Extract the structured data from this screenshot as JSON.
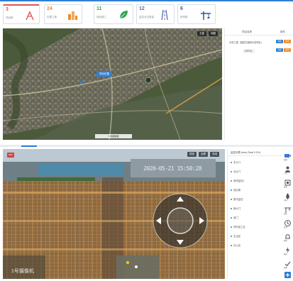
{
  "stats": [
    {
      "value": "3",
      "label": "项目数",
      "icon": "crane-icon"
    },
    {
      "value": "24",
      "label": "在建工程",
      "icon": "building-icon"
    },
    {
      "value": "11",
      "label": "绿色施工",
      "icon": "leaf-icon"
    },
    {
      "value": "12",
      "label": "监控点位数量",
      "icon": "road-icon"
    },
    {
      "value": "6",
      "label": "塔吊数",
      "icon": "tower-crane-icon"
    }
  ],
  "map": {
    "tool_1": "卫星",
    "tool_2": "地图",
    "pin_label": "项目位置",
    "status": "© 地图数据"
  },
  "table": {
    "col_name": "项目名称",
    "col_action": "操作",
    "rows": [
      {
        "name": "示范工程（装配式建筑示范项目）",
        "btn1": "查看",
        "btn2": "定位"
      },
      {
        "name": "工程项目二",
        "btn1": "查看",
        "btn2": "定位"
      }
    ]
  },
  "video": {
    "rec": "REC",
    "tool_1": "抓拍",
    "tool_2": "全屏",
    "tool_3": "关闭",
    "timestamp": "2020-05-21 15:50:28",
    "caption": "1号摄像机"
  },
  "cameras": {
    "header": "监控列表 Area (Total 3 CH)",
    "items": [
      "东大门",
      "北大门",
      "塔吊监控1",
      "西北角",
      "基坑监控",
      "南大门",
      "西门",
      "材料加工区",
      "生活区",
      "办公区"
    ]
  },
  "rail": [
    "视频",
    "人员",
    "设备",
    "环境",
    "塔吊",
    "监测",
    "报警",
    "能耗",
    "质量",
    "安全"
  ],
  "colors": {
    "accent": "#2f7fd6",
    "red": "#e05353",
    "orange": "#f08b25",
    "green": "#30a552"
  }
}
